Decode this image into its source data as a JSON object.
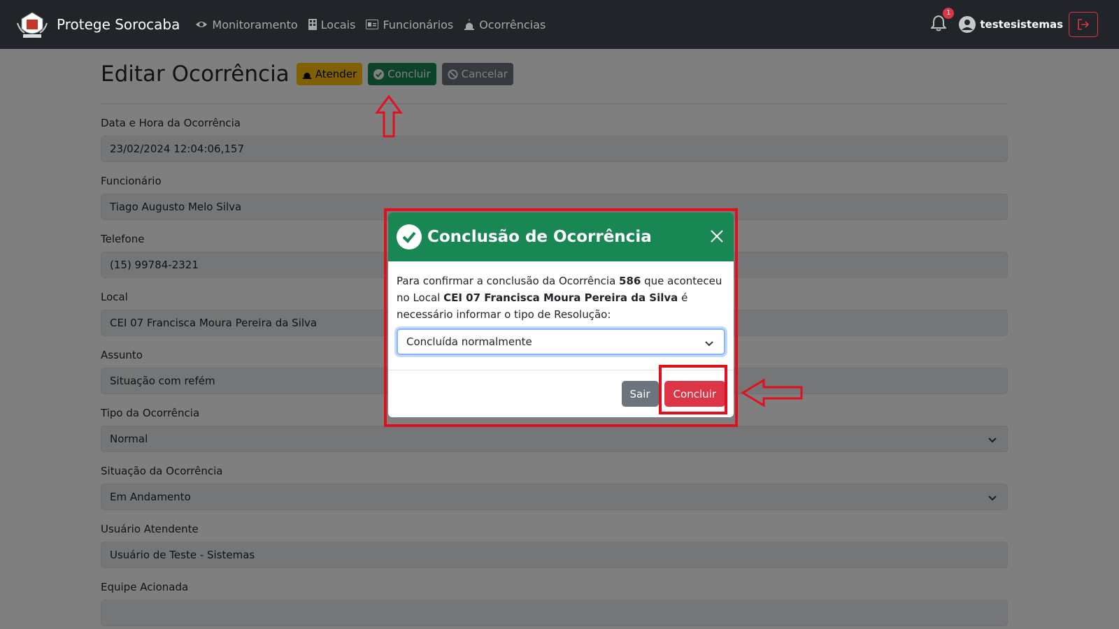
{
  "navbar": {
    "brand": "Protege Sorocaba",
    "links": [
      "Monitoramento",
      "Locais",
      "Funcionários",
      "Ocorrências"
    ],
    "notification_count": "1",
    "username": "testesistemas"
  },
  "page": {
    "title": "Editar Ocorrência",
    "buttons": {
      "atender": "Atender",
      "concluir": "Concluir",
      "cancelar": "Cancelar"
    },
    "fields": [
      {
        "label": "Data e Hora da Ocorrência",
        "value": "23/02/2024 12:04:06,157",
        "type": "input"
      },
      {
        "label": "Funcionário",
        "value": "Tiago Augusto Melo Silva",
        "type": "input"
      },
      {
        "label": "Telefone",
        "value": "(15) 99784-2321",
        "type": "input"
      },
      {
        "label": "Local",
        "value": "CEI 07 Francisca Moura Pereira da Silva",
        "type": "input"
      },
      {
        "label": "Assunto",
        "value": "Situação com refém",
        "type": "input"
      },
      {
        "label": "Tipo da Ocorrência",
        "value": "Normal",
        "type": "select"
      },
      {
        "label": "Situação da Ocorrência",
        "value": "Em Andamento",
        "type": "select"
      },
      {
        "label": "Usuário Atendente",
        "value": "Usuário de Teste - Sistemas",
        "type": "input"
      },
      {
        "label": "Equipe Acionada",
        "value": "",
        "type": "input"
      }
    ]
  },
  "modal": {
    "title": "Conclusão de Ocorrência",
    "text_1": "Para confirmar a conclusão da Ocorrência ",
    "ocorrencia_num": "586",
    "text_2": " que aconteceu no Local ",
    "local": "CEI 07 Francisca Moura Pereira da Silva",
    "text_3": " é necessário informar o tipo de Resolução:",
    "select_value": "Concluída normalmente",
    "sair": "Sair",
    "concluir": "Concluir"
  },
  "colors": {
    "navbar": "#212529",
    "success": "#198754",
    "danger": "#dc3545",
    "warning": "#ffc107",
    "annotation": "#e0101f"
  }
}
